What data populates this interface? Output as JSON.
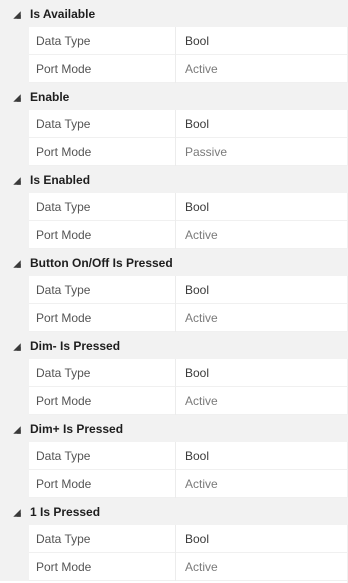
{
  "groups": [
    {
      "title": "Is Available",
      "properties": [
        {
          "name": "Data Type",
          "value": "Bool",
          "readonly": false
        },
        {
          "name": "Port Mode",
          "value": "Active",
          "readonly": true
        }
      ]
    },
    {
      "title": "Enable",
      "properties": [
        {
          "name": "Data Type",
          "value": "Bool",
          "readonly": false
        },
        {
          "name": "Port Mode",
          "value": "Passive",
          "readonly": true
        }
      ]
    },
    {
      "title": "Is Enabled",
      "properties": [
        {
          "name": "Data Type",
          "value": "Bool",
          "readonly": false
        },
        {
          "name": "Port Mode",
          "value": "Active",
          "readonly": true
        }
      ]
    },
    {
      "title": "Button On/Off Is Pressed",
      "properties": [
        {
          "name": "Data Type",
          "value": "Bool",
          "readonly": false
        },
        {
          "name": "Port Mode",
          "value": "Active",
          "readonly": true
        }
      ]
    },
    {
      "title": "Dim- Is Pressed",
      "properties": [
        {
          "name": "Data Type",
          "value": "Bool",
          "readonly": false
        },
        {
          "name": "Port Mode",
          "value": "Active",
          "readonly": true
        }
      ]
    },
    {
      "title": "Dim+ Is Pressed",
      "properties": [
        {
          "name": "Data Type",
          "value": "Bool",
          "readonly": false
        },
        {
          "name": "Port Mode",
          "value": "Active",
          "readonly": true
        }
      ]
    },
    {
      "title": "1 Is Pressed",
      "properties": [
        {
          "name": "Data Type",
          "value": "Bool",
          "readonly": false
        },
        {
          "name": "Port Mode",
          "value": "Active",
          "readonly": true
        }
      ]
    }
  ],
  "icons": {
    "expander": "collapse-triangle-icon"
  },
  "colors": {
    "category_background": "#f2f2f2",
    "readonly_text": "#7a7a7a",
    "editable_text": "#3a3a3a"
  }
}
